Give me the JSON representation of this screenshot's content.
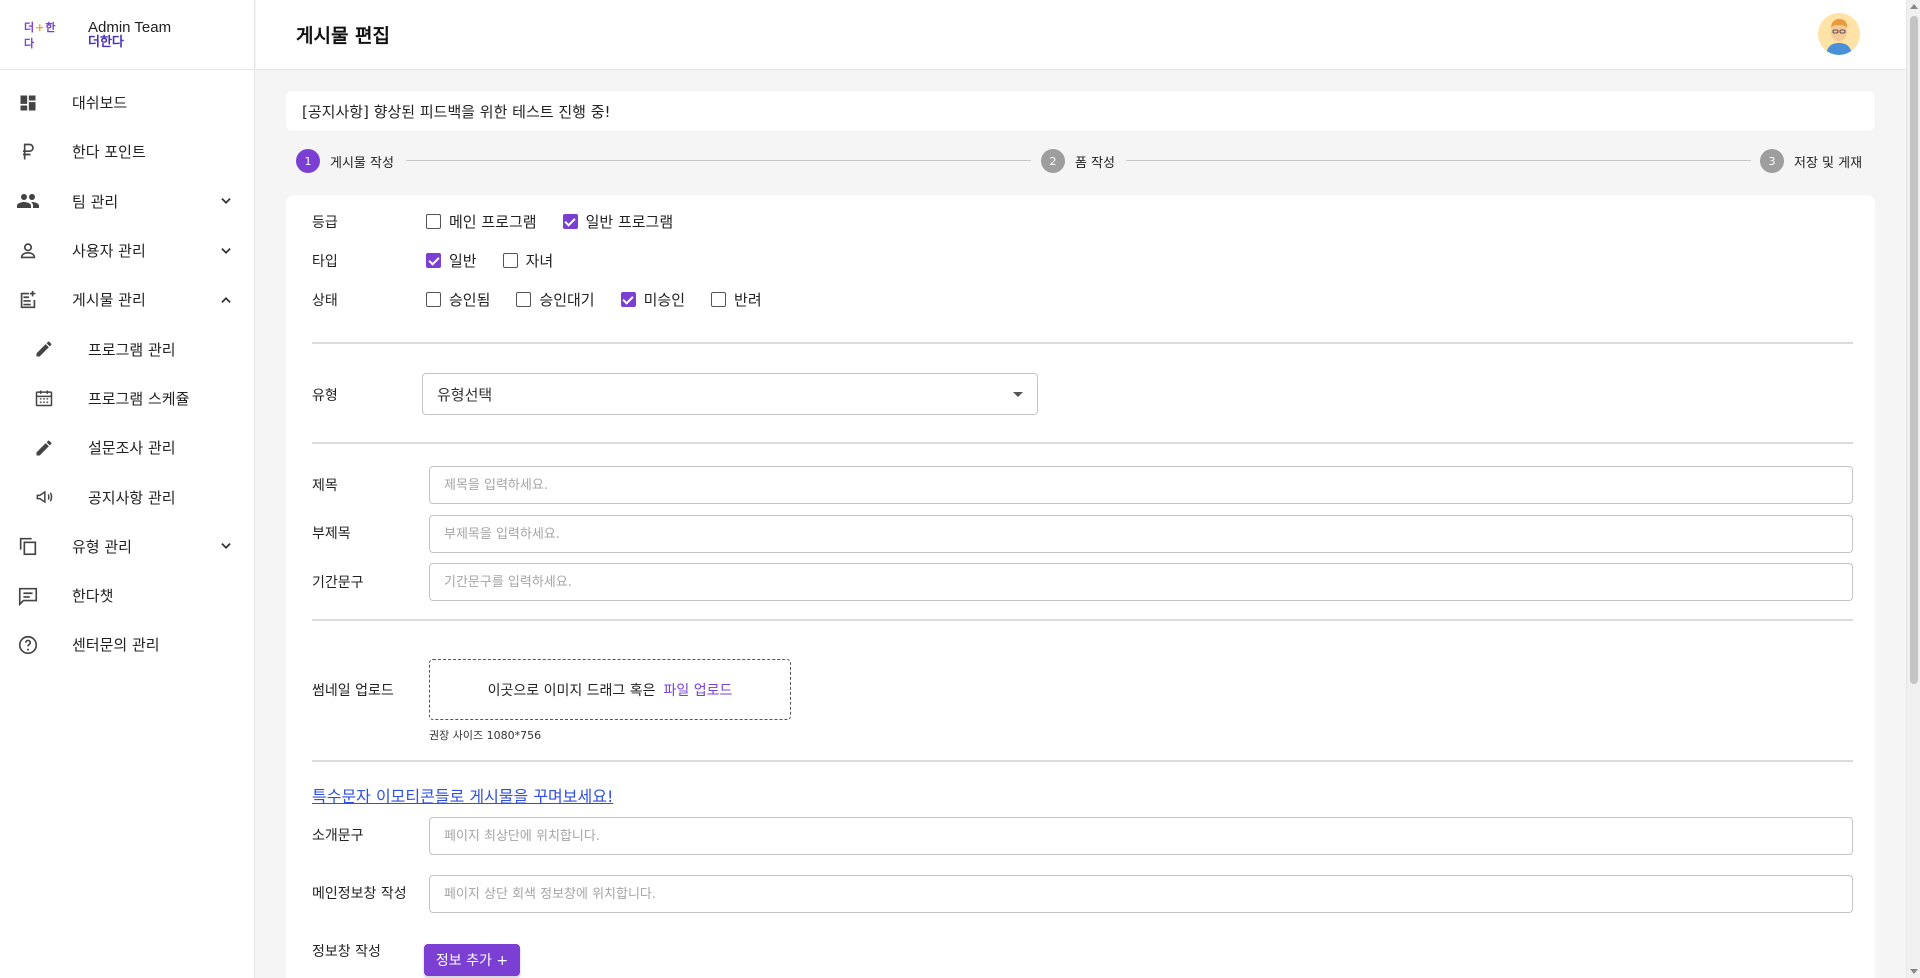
{
  "brand": {
    "logo_main": "더",
    "logo_accent": "+",
    "logo_rest": "한 다",
    "title": "Admin Team",
    "subtitle": "더한다"
  },
  "sidebar": {
    "items": [
      {
        "label": "대쉬보드",
        "icon": "dashboard-icon"
      },
      {
        "label": "한다 포인트",
        "icon": "ruble-icon"
      },
      {
        "label": "팀 관리",
        "icon": "group-icon",
        "expand": "down"
      },
      {
        "label": "사용자 관리",
        "icon": "person-icon",
        "expand": "down"
      },
      {
        "label": "게시물 관리",
        "icon": "post-add-icon",
        "expand": "up"
      },
      {
        "label": "프로그램 관리",
        "icon": "pencil-icon",
        "sub": true
      },
      {
        "label": "프로그램 스케쥴",
        "icon": "calendar-icon",
        "sub": true
      },
      {
        "label": "설문조사 관리",
        "icon": "pencil-icon",
        "sub": true
      },
      {
        "label": "공지사항 관리",
        "icon": "megaphone-icon",
        "sub": true
      },
      {
        "label": "유형 관리",
        "icon": "copy-icon",
        "expand": "down"
      },
      {
        "label": "한다챗",
        "icon": "chat-icon"
      },
      {
        "label": "센터문의 관리",
        "icon": "help-icon"
      }
    ]
  },
  "header": {
    "title": "게시물 편집"
  },
  "notice": "[공지사항] 향상된 피드백을 위한 테스트 진행 중!",
  "stepper": {
    "steps": [
      {
        "num": "1",
        "label": "게시물 작성",
        "active": true
      },
      {
        "num": "2",
        "label": "폼 작성",
        "active": false
      },
      {
        "num": "3",
        "label": "저장 및 게재",
        "active": false
      }
    ]
  },
  "form": {
    "grade": {
      "label": "등급",
      "options": [
        {
          "label": "메인 프로그램",
          "checked": false
        },
        {
          "label": "일반 프로그램",
          "checked": true
        }
      ]
    },
    "type": {
      "label": "타입",
      "options": [
        {
          "label": "일반",
          "checked": true
        },
        {
          "label": "자녀",
          "checked": false
        }
      ]
    },
    "status": {
      "label": "상태",
      "options": [
        {
          "label": "승인됨",
          "checked": false
        },
        {
          "label": "승인대기",
          "checked": false
        },
        {
          "label": "미승인",
          "checked": true
        },
        {
          "label": "반려",
          "checked": false
        }
      ]
    },
    "category": {
      "label": "유형",
      "value": "유형선택"
    },
    "title_field": {
      "label": "제목",
      "placeholder": "제목을 입력하세요."
    },
    "subtitle_field": {
      "label": "부제목",
      "placeholder": "부제목을 입력하세요."
    },
    "period_field": {
      "label": "기간문구",
      "placeholder": "기간문구를 입력하세요."
    },
    "thumbnail": {
      "label": "썸네일 업로드",
      "drop_text": "이곳으로 이미지 드래그 혹은",
      "link_text": "파일 업로드",
      "hint": "권장 사이즈 1080*756"
    },
    "emoji_link": "특수문자 이모티콘들로 게시물을 꾸며보세요!",
    "intro_field": {
      "label": "소개문구",
      "placeholder": "페이지 최상단에 위치합니다."
    },
    "main_info_field": {
      "label": "메인정보창 작성",
      "placeholder": "페이지 상단 회색 정보창에 위치합니다."
    },
    "info_section": {
      "label": "정보창 작성",
      "button": "정보 추가 +"
    }
  },
  "colors": {
    "accent": "#7b3fd4",
    "link": "#3050e0",
    "step_inactive": "#9e9e9e"
  }
}
